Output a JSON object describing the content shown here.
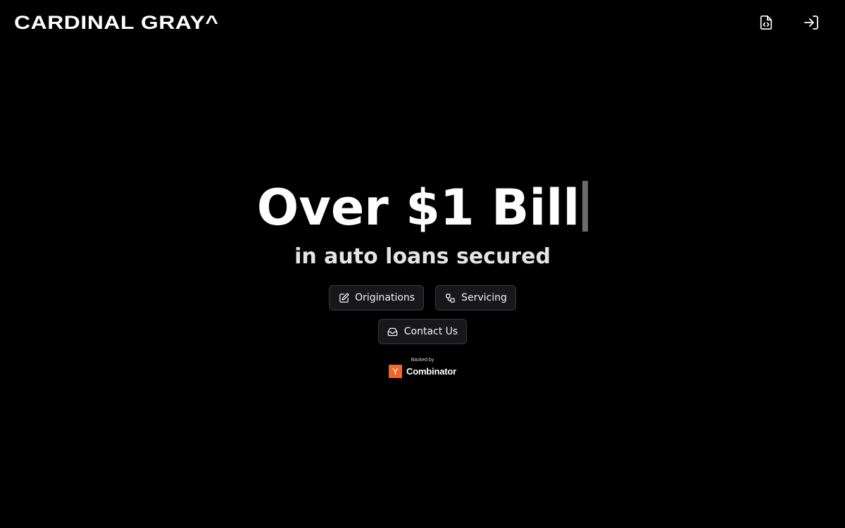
{
  "header": {
    "logo_text": "CARDINAL GRAY^",
    "icons": [
      "file-code-icon",
      "log-in-icon"
    ]
  },
  "hero": {
    "headline": "Over $1 Bill",
    "subhead": "in auto loans secured"
  },
  "buttons": {
    "originations": {
      "label": "Originations",
      "icon": "pencil-square-icon"
    },
    "servicing": {
      "label": "Servicing",
      "icon": "workflow-icon"
    },
    "contact": {
      "label": "Contact Us",
      "icon": "inbox-icon"
    }
  },
  "backer": {
    "backed_by": "Backed by",
    "badge_letter": "Y",
    "name": "Combinator",
    "brand_color": "#f26625"
  },
  "colors": {
    "background": "#000000",
    "text": "#ffffff",
    "button_bg": "#18181b",
    "button_border": "#3a3a3d",
    "cursor": "#6b6b6b"
  }
}
